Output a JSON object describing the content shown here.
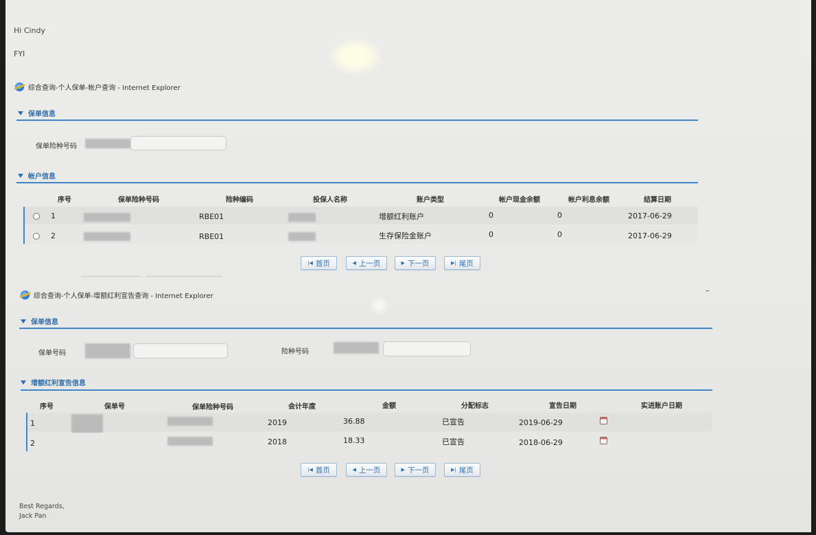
{
  "email": {
    "greeting": "Hi Cindy",
    "fyi": "FYI",
    "signoff": "Best Regards,",
    "signature": "Jack Pan"
  },
  "window1": {
    "title": "综合查询-个人保单-帐户查询 - Internet Explorer",
    "policy_section": "保单信息",
    "policy_field_label": "保单险种号码",
    "account_section": "帐户信息",
    "columns": [
      "序号",
      "保单险种号码",
      "险种编码",
      "投保人名称",
      "账户类型",
      "帐户现金余额",
      "帐户利息余额",
      "结算日期"
    ],
    "rows": [
      {
        "seq": "1",
        "code": "RBE01",
        "type": "增额红利账户",
        "cash": "0",
        "interest": "0",
        "date": "2017-06-29"
      },
      {
        "seq": "2",
        "code": "RBE01",
        "type": "生存保险金账户",
        "cash": "0",
        "interest": "0",
        "date": "2017-06-29"
      }
    ],
    "pager": {
      "first": "首页",
      "prev": "上一页",
      "next": "下一页",
      "last": "尾页"
    }
  },
  "window2": {
    "title": "综合查询-个人保单-增额红利宣告查询 - Internet Explorer",
    "policy_section": "保单信息",
    "policy_no_label": "保单号码",
    "risk_code_label": "险种号码",
    "bonus_section": "增额红利宣告信息",
    "columns": [
      "序号",
      "保单号",
      "保单险种号码",
      "会计年度",
      "金额",
      "分配标志",
      "宣告日期",
      "实进账户日期"
    ],
    "rows": [
      {
        "seq": "1",
        "year": "2019",
        "amount": "36.88",
        "flag": "已宣告",
        "date": "2019-06-29"
      },
      {
        "seq": "2",
        "year": "2018",
        "amount": "18.33",
        "flag": "已宣告",
        "date": "2018-06-29"
      }
    ],
    "pager": {
      "first": "首页",
      "prev": "上一页",
      "next": "下一页",
      "last": "尾页"
    },
    "minimize": "–"
  },
  "colors": {
    "accent": "#3d86c6",
    "section_text": "#2f6fae"
  }
}
